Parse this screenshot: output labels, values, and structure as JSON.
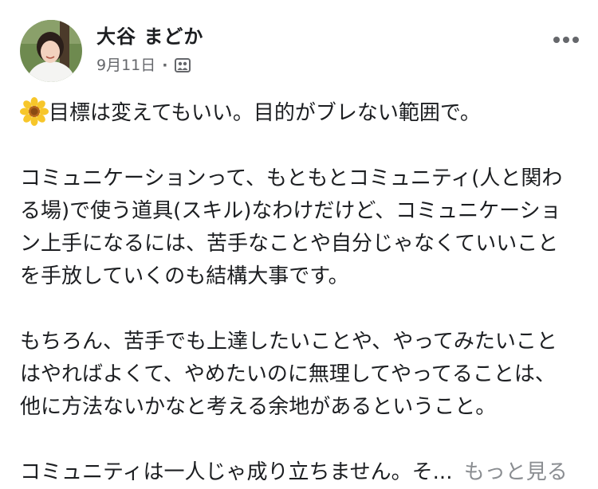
{
  "post": {
    "author_name": "大谷 まどか",
    "date": "9月11日",
    "separator": "·",
    "privacy_icon": "friends-group-icon",
    "more_icon": "more-horizontal-icon",
    "avatar": "profile-photo",
    "lines": [
      "目標は変えてもいい。目的がブレない範囲で。",
      "",
      "コミュニケーションって、もともとコミュニティ(人と関わ",
      "る場)で使う道具(スキル)なわけだけど、コミュニケーショ",
      "ン上手になるには、苦手なことや自分じゃなくていいこと",
      "を手放していくのも結構大事です。",
      "",
      "もちろん、苦手でも上達したいことや、やってみたいこと",
      "はやればよくて、やめたいのに無理してやってることは、",
      "他に方法ないかなと考える余地があるということ。",
      "",
      "コミュニティは一人じゃ成り立ちません。そ..."
    ],
    "first_line_icon": "sunflower-icon",
    "see_more_label": "もっと見る"
  }
}
